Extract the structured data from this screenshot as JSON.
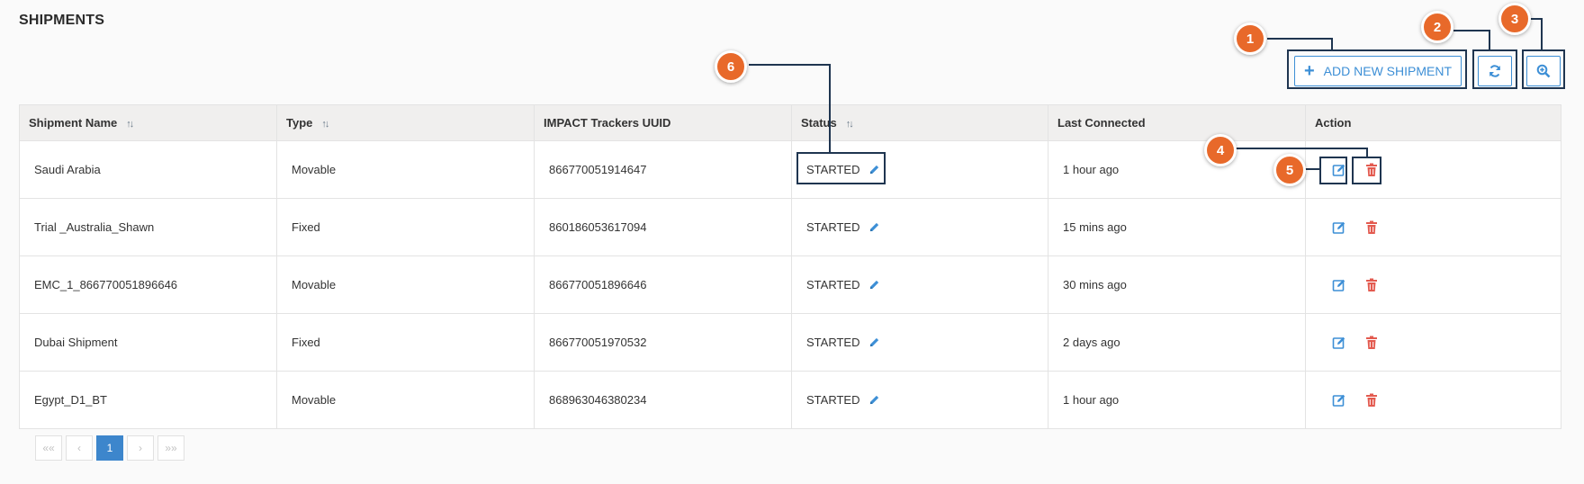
{
  "page": {
    "title": "SHIPMENTS"
  },
  "toolbar": {
    "add_label": "ADD NEW SHIPMENT",
    "add_icon": "plus-icon",
    "refresh_icon": "refresh-icon",
    "zoom_icon": "zoom-in-icon"
  },
  "table": {
    "headers": [
      "Shipment Name",
      "Type",
      "IMPACT Trackers UUID",
      "Status",
      "Last Connected",
      "Action"
    ],
    "rows": [
      {
        "name": "Saudi Arabia",
        "type": "Movable",
        "uuid": "866770051914647",
        "status": "STARTED",
        "last": "1 hour ago"
      },
      {
        "name": "Trial _Australia_Shawn",
        "type": "Fixed",
        "uuid": "860186053617094",
        "status": "STARTED",
        "last": "15 mins ago"
      },
      {
        "name": "EMC_1_866770051896646",
        "type": "Movable",
        "uuid": "866770051896646",
        "status": "STARTED",
        "last": "30 mins ago"
      },
      {
        "name": "Dubai Shipment",
        "type": "Fixed",
        "uuid": "866770051970532",
        "status": "STARTED",
        "last": "2 days ago"
      },
      {
        "name": "Egypt_D1_BT",
        "type": "Movable",
        "uuid": "868963046380234",
        "status": "STARTED",
        "last": "1 hour ago"
      }
    ]
  },
  "pagination": {
    "first": "««",
    "prev": "‹",
    "current": "1",
    "next": "›",
    "last": "»»"
  },
  "callouts": [
    "1",
    "2",
    "3",
    "4",
    "5",
    "6"
  ],
  "colors": {
    "accent": "#3d8fd6",
    "delete": "#e35a4f",
    "callout": "#e8692a",
    "highlight": "#1f3550"
  }
}
